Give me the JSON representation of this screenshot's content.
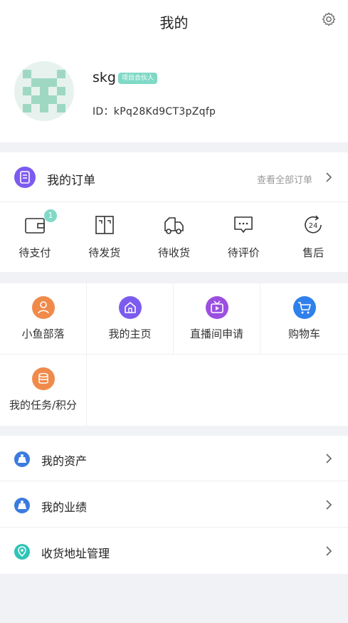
{
  "header": {
    "title": "我的",
    "settings_icon": "gear-icon"
  },
  "profile": {
    "username": "skg",
    "role_badge": "项目合伙人",
    "id_text": "ID：kPq28Kd9CT3pZqfp",
    "avatar_icon": "pixel-avatar"
  },
  "orders": {
    "title": "我的订单",
    "view_all": "查看全部订单",
    "statuses": [
      {
        "label": "待支付",
        "icon": "wallet-icon",
        "badge": "1"
      },
      {
        "label": "待发货",
        "icon": "box-icon"
      },
      {
        "label": "待收货",
        "icon": "truck-icon"
      },
      {
        "label": "待评价",
        "icon": "comment-icon"
      },
      {
        "label": "售后",
        "icon": "24h-icon",
        "icon_text": "24"
      }
    ]
  },
  "tools": [
    {
      "label": "小鱼部落",
      "icon": "community-icon",
      "color": "#f08a4b"
    },
    {
      "label": "我的主页",
      "icon": "home-icon",
      "color": "#7c5bef"
    },
    {
      "label": "直播间申请",
      "icon": "tv-icon",
      "color": "#9b4fe0"
    },
    {
      "label": "购物车",
      "icon": "cart-icon",
      "color": "#2f80ed"
    },
    {
      "label": "我的任务/积分",
      "icon": "coins-icon",
      "color": "#f08a4b"
    }
  ],
  "menu": [
    {
      "label": "我的资产",
      "icon": "asset-icon",
      "color": "#3b7be0"
    },
    {
      "label": "我的业绩",
      "icon": "performance-icon",
      "color": "#3b7be0"
    },
    {
      "label": "收货地址管理",
      "icon": "location-icon",
      "color": "#2ec4b6"
    }
  ],
  "colors": {
    "accent": "#7fd9c6",
    "purple": "#7c5bef",
    "background": "#f1f2f6"
  }
}
